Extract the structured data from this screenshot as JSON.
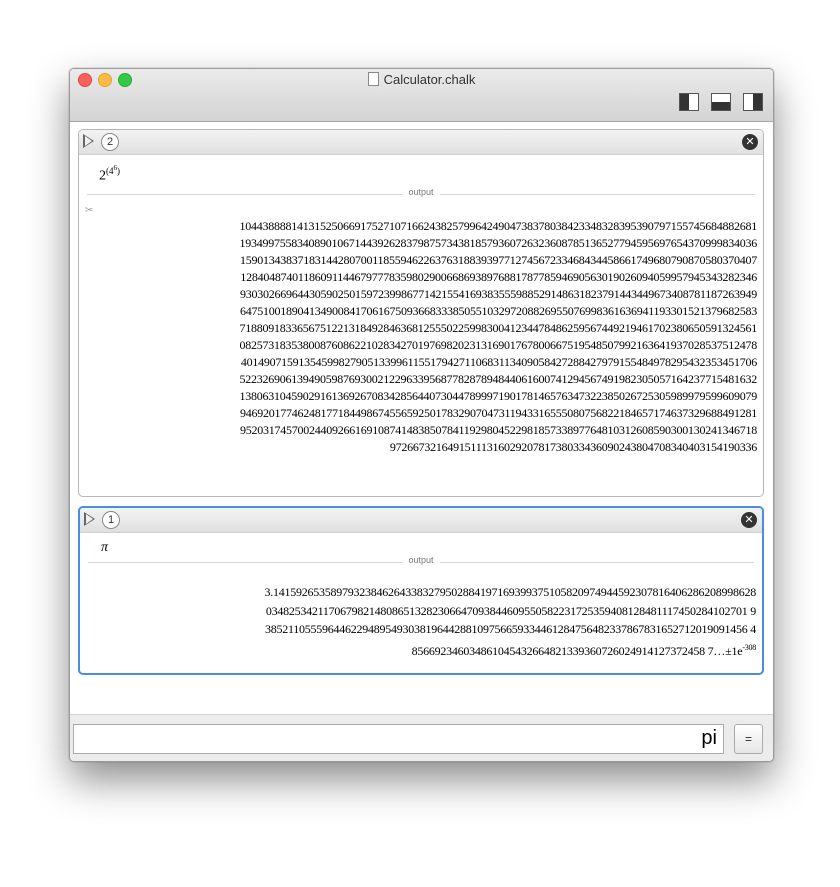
{
  "window": {
    "title": "Calculator.chalk",
    "traffic_colors": {
      "close": "#fc605c",
      "minimize": "#fdbc40",
      "maximize": "#34c84a"
    },
    "layout_buttons": [
      "layout-left-icon",
      "layout-bottom-icon",
      "layout-right-icon"
    ]
  },
  "cells": [
    {
      "number": "2",
      "expression": {
        "base": "2",
        "exp_open": "(",
        "exp_base": "4",
        "exp_exp": "6",
        "exp_close": ")"
      },
      "output_label": "output",
      "output": "1044388881413152506691752710716624382579964249047383780384233483283953907971557456848826811934997558340890106714439262837987573438185793607263236087851365277945956976543709998340361590134383718314428070011855946226376318839397712745672334684344586617496807908705803704071284048740118609114467977783598029006686938976881787785946905630190260940599579453432823469303026696443059025015972399867714215541693835559885291486318237914434496734087811872639496475100189041349008417061675093668333850551032972088269550769983616369411933015213796825837188091833656751221318492846368125550225998300412344784862595674492194617023806505913245610825731835380087608622102834270197698202313169017678006675195485079921636419370285375124784014907159135459982790513399611551794271106831134090584272884279791554849782954323534517065223269061394905987693002122963395687782878948440616007412945674919823050571642377154816321380631045902916136926708342856440730447899971901781465763473223850267253059899795996090799469201774624817718449867455659250178329070473119433165550807568221846571746373296884912819520317457002440926616910874148385078411929804522981857338977648103126085903001302413467189726673216491511131602920781738033436090243804708340403154190336"
    },
    {
      "number": "1",
      "expression": {
        "symbol": "π"
      },
      "output_label": "output",
      "output_lines": [
        "3.141592653589793238462643383279502884197169399375105820974944592307816406286208998628",
        "034825342117067982148086513282306647093844609550582231725359408128481117450284102701 9",
        "385211055596446229489549303819644288109756659334461284756482337867831652712019091456 4",
        "856692346034861045432664821339360726024914127372458 7…±1e"
      ],
      "output_exponent": "-308"
    }
  ],
  "input": {
    "value": "pi",
    "equals_label": "="
  }
}
